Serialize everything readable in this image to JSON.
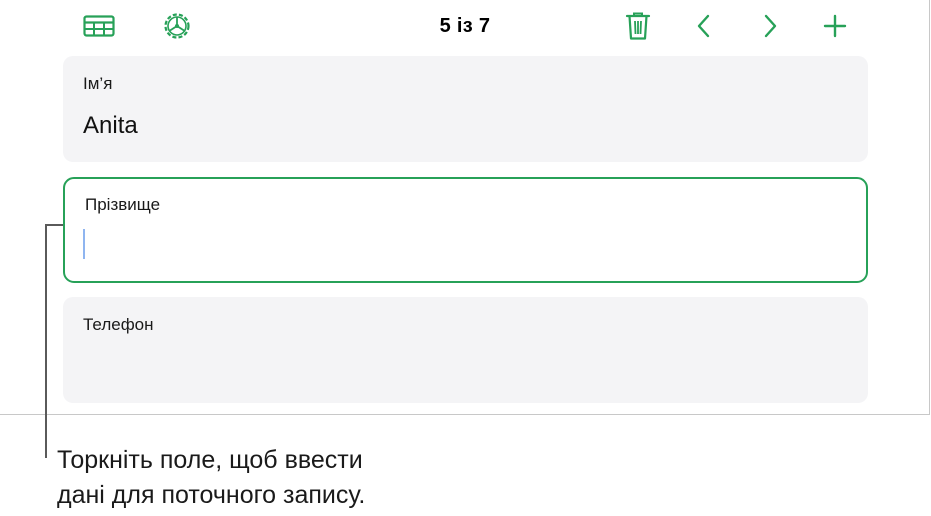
{
  "toolbar": {
    "record_counter": "5 із 7",
    "icons": {
      "table": "table-grid-icon",
      "settings": "gear-icon",
      "delete": "trash-icon",
      "previous": "chevron-left-icon",
      "next": "chevron-right-icon",
      "add": "plus-icon"
    }
  },
  "fields": [
    {
      "label": "Ім’я",
      "value": "Anita",
      "active": false
    },
    {
      "label": "Прізвище",
      "value": "",
      "active": true
    },
    {
      "label": "Телефон",
      "value": "",
      "active": false
    }
  ],
  "callout": {
    "line1": "Торкніть поле, щоб ввести",
    "line2": "дані для поточного запису."
  },
  "colors": {
    "accent_green": "#27a158",
    "card_background": "#f4f4f6",
    "caret_blue": "#8fb5f0"
  }
}
